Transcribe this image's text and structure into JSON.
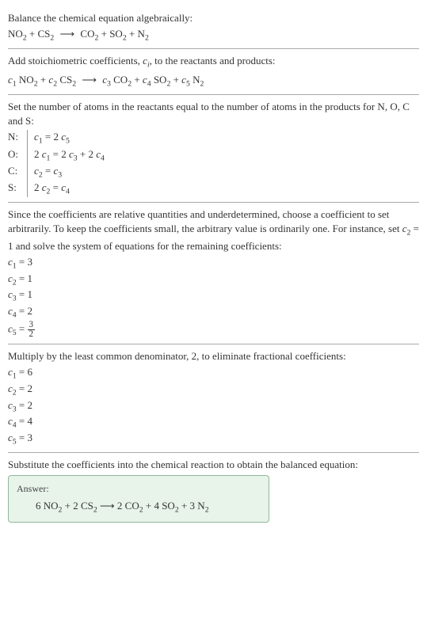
{
  "sec1": {
    "title": "Balance the chemical equation algebraically:",
    "eq_parts": {
      "r1": "NO",
      "r1s": "2",
      "r2": "CS",
      "r2s": "2",
      "arrow": "⟶",
      "p1": "CO",
      "p1s": "2",
      "p2": "SO",
      "p2s": "2",
      "p3": "N",
      "p3s": "2"
    }
  },
  "sec2": {
    "title_a": "Add stoichiometric coefficients, ",
    "title_ci": "c",
    "title_ci_sub": "i",
    "title_b": ", to the reactants and products:",
    "c1": "c",
    "c1s": "1",
    "r1": " NO",
    "r1s": "2",
    "c2": "c",
    "c2s": "2",
    "r2": " CS",
    "r2s": "2",
    "arrow": "⟶",
    "c3": "c",
    "c3s": "3",
    "p1": " CO",
    "p1s": "2",
    "c4": "c",
    "c4s": "4",
    "p2": " SO",
    "p2s": "2",
    "c5": "c",
    "c5s": "5",
    "p3": " N",
    "p3s": "2"
  },
  "sec3": {
    "title": "Set the number of atoms in the reactants equal to the number of atoms in the products for N, O, C and S:",
    "rows": {
      "N": {
        "label": "N:",
        "lhs_c": "c",
        "lhs_s": "1",
        "eq": " = 2 ",
        "rhs_c": "c",
        "rhs_s": "5"
      },
      "O": {
        "label": "O:",
        "pre": "2 ",
        "lhs_c": "c",
        "lhs_s": "1",
        "eq": " = 2 ",
        "m_c": "c",
        "m_s": "3",
        "plus": " + 2 ",
        "rhs_c": "c",
        "rhs_s": "4"
      },
      "C": {
        "label": "C:",
        "lhs_c": "c",
        "lhs_s": "2",
        "eq": " = ",
        "rhs_c": "c",
        "rhs_s": "3"
      },
      "S": {
        "label": "S:",
        "pre": "2 ",
        "lhs_c": "c",
        "lhs_s": "2",
        "eq": " = ",
        "rhs_c": "c",
        "rhs_s": "4"
      }
    }
  },
  "sec4": {
    "text_a": "Since the coefficients are relative quantities and underdetermined, choose a coefficient to set arbitrarily. To keep the coefficients small, the arbitrary value is ordinarily one. For instance, set ",
    "set_c": "c",
    "set_s": "2",
    "set_eq": " = 1",
    "text_b": " and solve the system of equations for the remaining coefficients:",
    "coefs": {
      "c1": {
        "c": "c",
        "s": "1",
        "eq": " = 3"
      },
      "c2": {
        "c": "c",
        "s": "2",
        "eq": " = 1"
      },
      "c3": {
        "c": "c",
        "s": "3",
        "eq": " = 1"
      },
      "c4": {
        "c": "c",
        "s": "4",
        "eq": " = 2"
      },
      "c5": {
        "c": "c",
        "s": "5",
        "eq": " = ",
        "num": "3",
        "den": "2"
      }
    }
  },
  "sec5": {
    "title": "Multiply by the least common denominator, 2, to eliminate fractional coefficients:",
    "coefs": {
      "c1": {
        "c": "c",
        "s": "1",
        "eq": " = 6"
      },
      "c2": {
        "c": "c",
        "s": "2",
        "eq": " = 2"
      },
      "c3": {
        "c": "c",
        "s": "3",
        "eq": " = 2"
      },
      "c4": {
        "c": "c",
        "s": "4",
        "eq": " = 4"
      },
      "c5": {
        "c": "c",
        "s": "5",
        "eq": " = 3"
      }
    }
  },
  "sec6": {
    "title": "Substitute the coefficients into the chemical reaction to obtain the balanced equation:",
    "answer_label": "Answer:",
    "eq": {
      "n1": "6 ",
      "r1": "NO",
      "r1s": "2",
      "p1": " + ",
      "n2": "2 ",
      "r2": "CS",
      "r2s": "2",
      "arrow": " ⟶ ",
      "n3": "2 ",
      "pr1": "CO",
      "pr1s": "2",
      "p2": " + ",
      "n4": "4 ",
      "pr2": "SO",
      "pr2s": "2",
      "p3": " + ",
      "n5": "3 ",
      "pr3": "N",
      "pr3s": "2"
    }
  },
  "chart_data": {
    "type": "table",
    "title": "Balanced chemical equation coefficients",
    "reaction_unbalanced": "NO2 + CS2 -> CO2 + SO2 + N2",
    "atom_balance_equations": [
      {
        "element": "N",
        "equation": "c1 = 2*c5"
      },
      {
        "element": "O",
        "equation": "2*c1 = 2*c3 + 2*c4"
      },
      {
        "element": "C",
        "equation": "c2 = c3"
      },
      {
        "element": "S",
        "equation": "2*c2 = c4"
      }
    ],
    "coefficients_initial": {
      "c1": 3,
      "c2": 1,
      "c3": 1,
      "c4": 2,
      "c5": 1.5
    },
    "lcm": 2,
    "coefficients_final": {
      "c1": 6,
      "c2": 2,
      "c3": 2,
      "c4": 4,
      "c5": 3
    },
    "reaction_balanced": "6 NO2 + 2 CS2 -> 2 CO2 + 4 SO2 + 3 N2"
  }
}
